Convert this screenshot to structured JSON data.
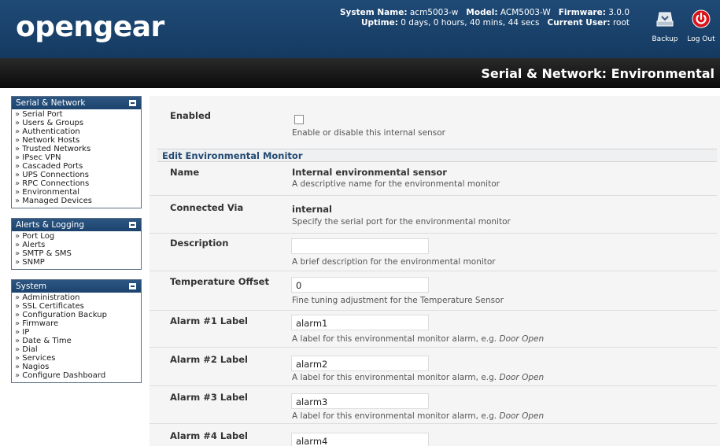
{
  "header": {
    "logo": "opengear",
    "system_name_label": "System Name:",
    "system_name": "acm5003-w",
    "model_label": "Model:",
    "model": "ACM5003-W",
    "firmware_label": "Firmware:",
    "firmware": "3.0.0",
    "uptime_label": "Uptime:",
    "uptime": "0 days, 0 hours, 40 mins, 44 secs",
    "user_label": "Current User:",
    "user": "root",
    "backup_label": "Backup",
    "logout_label": "Log Out"
  },
  "page_title": "Serial & Network: Environmental",
  "sidebar": {
    "sections": [
      {
        "title": "Serial & Network",
        "items": [
          "Serial Port",
          "Users & Groups",
          "Authentication",
          "Network Hosts",
          "Trusted Networks",
          "IPsec VPN",
          "Cascaded Ports",
          "UPS Connections",
          "RPC Connections",
          "Environmental",
          "Managed Devices"
        ]
      },
      {
        "title": "Alerts & Logging",
        "items": [
          "Port Log",
          "Alerts",
          "SMTP & SMS",
          "SNMP"
        ]
      },
      {
        "title": "System",
        "items": [
          "Administration",
          "SSL Certificates",
          "Configuration Backup",
          "Firmware",
          "IP",
          "Date & Time",
          "Dial",
          "Services",
          "Nagios",
          "Configure Dashboard"
        ]
      }
    ]
  },
  "form": {
    "enabled": {
      "label": "Enabled",
      "checked": false,
      "hint": "Enable or disable this internal sensor"
    },
    "section_title": "Edit Environmental Monitor",
    "name": {
      "label": "Name",
      "value": "Internal environmental sensor",
      "hint": "A descriptive name for the environmental monitor"
    },
    "connected_via": {
      "label": "Connected Via",
      "value": "internal",
      "hint": "Specify the serial port for the environmental monitor"
    },
    "description": {
      "label": "Description",
      "value": "",
      "hint": "A brief description for the environmental monitor"
    },
    "temp_offset": {
      "label": "Temperature Offset",
      "value": "0",
      "hint": "Fine tuning adjustment for the Temperature Sensor"
    },
    "alarms": [
      {
        "label": "Alarm #1 Label",
        "value": "alarm1",
        "hint": "A label for this environmental monitor alarm, e.g.",
        "example": "Door Open"
      },
      {
        "label": "Alarm #2 Label",
        "value": "alarm2",
        "hint": "A label for this environmental monitor alarm, e.g.",
        "example": "Door Open"
      },
      {
        "label": "Alarm #3 Label",
        "value": "alarm3",
        "hint": "A label for this environmental monitor alarm, e.g.",
        "example": "Door Open"
      },
      {
        "label": "Alarm #4 Label",
        "value": "alarm4"
      }
    ]
  },
  "colors": {
    "header_bg": "#1a4470",
    "titlebar_bg": "#111111",
    "nav_head_bg": "#234b76",
    "section_text": "#234a73",
    "logout_red": "#d9141b"
  },
  "icons": {
    "backup": "backup-tray-icon",
    "logout": "power-icon",
    "collapse": "collapse-minus-icon"
  }
}
